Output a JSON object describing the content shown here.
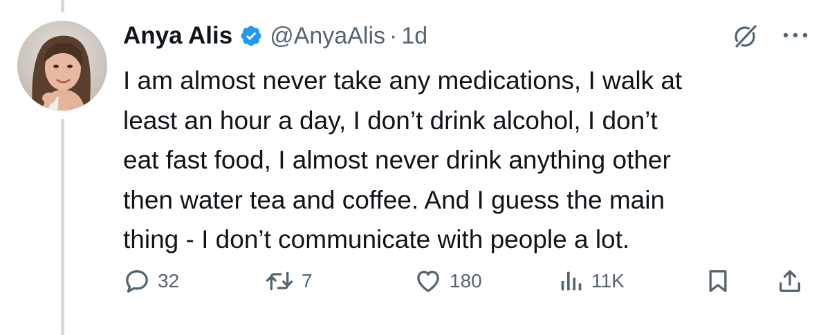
{
  "tweet": {
    "author_name": "Anya Alis",
    "handle": "@AnyaAlis",
    "separator": "·",
    "time": "1d",
    "verified": true,
    "text_lines": [
      "I am almost never take any medications, I walk at",
      "least an hour a day, I don’t drink alcohol, I don’t",
      "eat fast food, I almost never drink anything other",
      "then water tea and coffee. And I guess the main",
      "thing - I don’t communicate with people a lot."
    ]
  },
  "actions": {
    "replies": "32",
    "reposts": "7",
    "likes": "180",
    "views": "11K"
  },
  "icons": {
    "verified": "verified-badge-icon",
    "grok": "grok-icon",
    "more": "more-icon",
    "reply": "reply-icon",
    "repost": "repost-icon",
    "like": "heart-icon",
    "views": "views-icon",
    "bookmark": "bookmark-icon",
    "share": "share-icon"
  },
  "colors": {
    "text": "#0f1419",
    "secondary": "#536471",
    "verified": "#1d9bf0",
    "thread_line": "#cfd9de"
  }
}
